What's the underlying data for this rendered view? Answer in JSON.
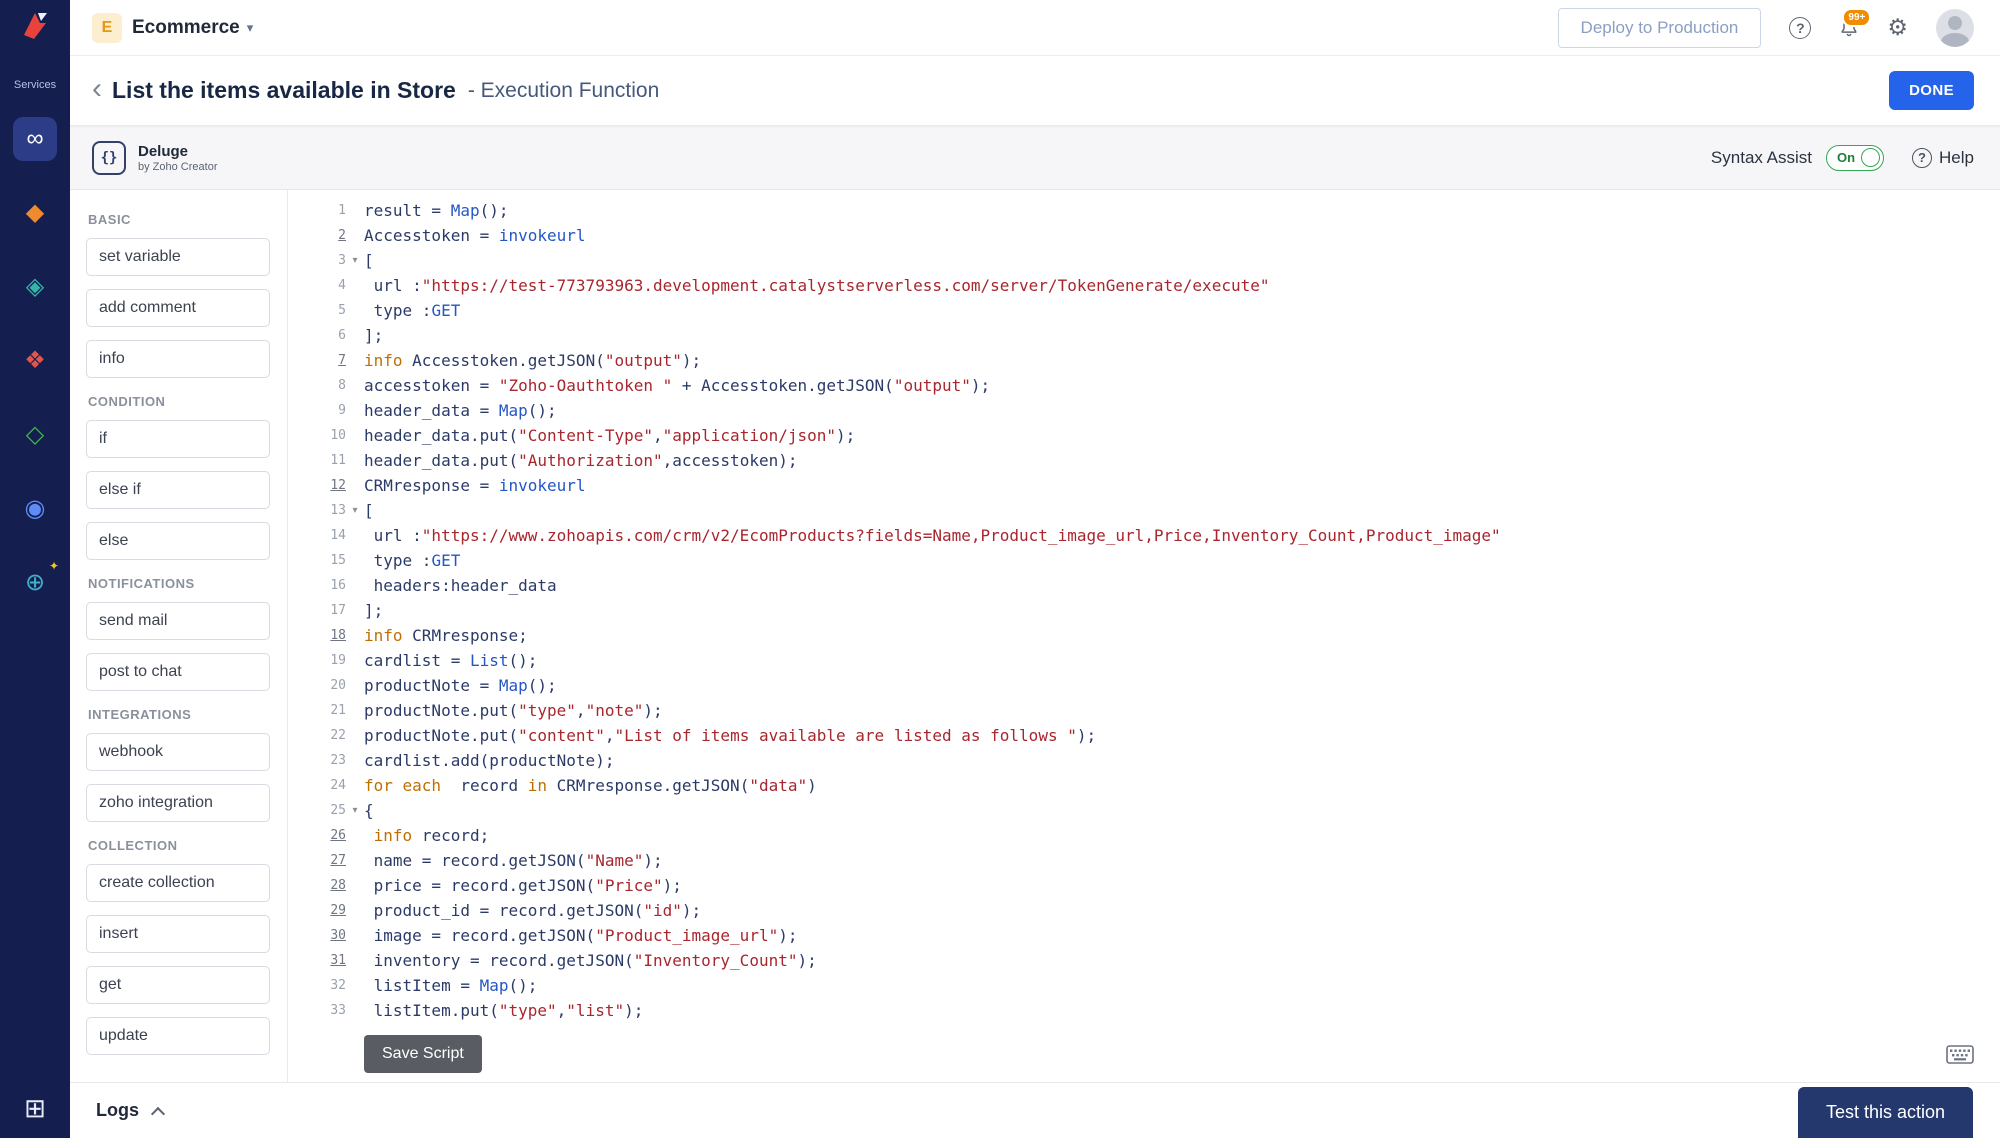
{
  "sidebar": {
    "services_label": "Services",
    "items": [
      {
        "name": "infinity-service",
        "glyph": "∞",
        "color": "#ffffff",
        "active": true
      },
      {
        "name": "diamond-orange-service",
        "glyph": "◆",
        "color": "#f08a2f"
      },
      {
        "name": "datastore-service",
        "glyph": "◈",
        "color": "#35b5a9"
      },
      {
        "name": "cluster-service",
        "glyph": "❖",
        "color": "#e0564d"
      },
      {
        "name": "diamond-green-service",
        "glyph": "◇",
        "color": "#43b649"
      },
      {
        "name": "user-service",
        "glyph": "◉",
        "color": "#5e8bf5"
      },
      {
        "name": "globe-service",
        "glyph": "⊕",
        "color": "#3fb0c9",
        "sparkle": true
      }
    ],
    "apps_grid_glyph": "⊞"
  },
  "topbar": {
    "app_badge": "E",
    "app_name": "Ecommerce",
    "caret": "▾",
    "deploy_label": "Deploy to Production",
    "notification_count": "99+",
    "help_glyph": "?",
    "gear_glyph": "⚙"
  },
  "header": {
    "back_glyph": "‹",
    "title": "List the items available in Store",
    "subtitle": "- Execution Function",
    "done_label": "DONE"
  },
  "editor_header": {
    "logo_glyph": "{}",
    "engine_name": "Deluge",
    "engine_sub": "by Zoho Creator",
    "syntax_assist_label": "Syntax Assist",
    "toggle_state": "On",
    "help_glyph": "?",
    "help_label": "Help"
  },
  "panel": {
    "sections": [
      {
        "label": "BASIC",
        "items": [
          "set variable",
          "add comment",
          "info"
        ]
      },
      {
        "label": "CONDITION",
        "items": [
          "if",
          "else if",
          "else"
        ]
      },
      {
        "label": "NOTIFICATIONS",
        "items": [
          "send mail",
          "post to chat"
        ]
      },
      {
        "label": "INTEGRATIONS",
        "items": [
          "webhook",
          "zoho integration"
        ]
      },
      {
        "label": "COLLECTION",
        "items": [
          "create collection",
          "insert",
          "get",
          "update"
        ]
      }
    ]
  },
  "code": {
    "lines": [
      {
        "n": 1,
        "t": [
          [
            "d",
            "result = "
          ],
          [
            "k",
            "Map"
          ],
          [
            "d",
            "();"
          ]
        ]
      },
      {
        "n": 2,
        "u": true,
        "t": [
          [
            "d",
            "Accesstoken = "
          ],
          [
            "k",
            "invokeurl"
          ]
        ]
      },
      {
        "n": 3,
        "fold": true,
        "t": [
          [
            "d",
            "["
          ]
        ]
      },
      {
        "n": 4,
        "t": [
          [
            "d",
            " url :"
          ],
          [
            "s",
            "\"https://test-773793963.development.catalystserverless.com/server/TokenGenerate/execute\""
          ]
        ]
      },
      {
        "n": 5,
        "t": [
          [
            "d",
            " type :"
          ],
          [
            "k",
            "GET"
          ]
        ]
      },
      {
        "n": 6,
        "t": [
          [
            "d",
            "];"
          ]
        ]
      },
      {
        "n": 7,
        "u": true,
        "t": [
          [
            "c",
            "info "
          ],
          [
            "d",
            "Accesstoken.getJSON("
          ],
          [
            "s",
            "\"output\""
          ],
          [
            "d",
            ");"
          ]
        ]
      },
      {
        "n": 8,
        "t": [
          [
            "d",
            "accesstoken = "
          ],
          [
            "s",
            "\"Zoho-Oauthtoken \""
          ],
          [
            "d",
            " + Accesstoken.getJSON("
          ],
          [
            "s",
            "\"output\""
          ],
          [
            "d",
            ");"
          ]
        ]
      },
      {
        "n": 9,
        "t": [
          [
            "d",
            "header_data = "
          ],
          [
            "k",
            "Map"
          ],
          [
            "d",
            "();"
          ]
        ]
      },
      {
        "n": 10,
        "t": [
          [
            "d",
            "header_data.put("
          ],
          [
            "s",
            "\"Content-Type\""
          ],
          [
            "d",
            ","
          ],
          [
            "s",
            "\"application/json\""
          ],
          [
            "d",
            ");"
          ]
        ]
      },
      {
        "n": 11,
        "t": [
          [
            "d",
            "header_data.put("
          ],
          [
            "s",
            "\"Authorization\""
          ],
          [
            "d",
            ",accesstoken);"
          ]
        ]
      },
      {
        "n": 12,
        "u": true,
        "t": [
          [
            "d",
            "CRMresponse = "
          ],
          [
            "k",
            "invokeurl"
          ]
        ]
      },
      {
        "n": 13,
        "fold": true,
        "t": [
          [
            "d",
            "["
          ]
        ]
      },
      {
        "n": 14,
        "t": [
          [
            "d",
            " url :"
          ],
          [
            "s",
            "\"https://www.zohoapis.com/crm/v2/EcomProducts?fields=Name,Product_image_url,Price,Inventory_Count,Product_image\""
          ]
        ]
      },
      {
        "n": 15,
        "t": [
          [
            "d",
            " type :"
          ],
          [
            "k",
            "GET"
          ]
        ]
      },
      {
        "n": 16,
        "t": [
          [
            "d",
            " headers:header_data"
          ]
        ]
      },
      {
        "n": 17,
        "t": [
          [
            "d",
            "];"
          ]
        ]
      },
      {
        "n": 18,
        "u": true,
        "t": [
          [
            "c",
            "info "
          ],
          [
            "d",
            "CRMresponse;"
          ]
        ]
      },
      {
        "n": 19,
        "t": [
          [
            "d",
            "cardlist = "
          ],
          [
            "k",
            "List"
          ],
          [
            "d",
            "();"
          ]
        ]
      },
      {
        "n": 20,
        "t": [
          [
            "d",
            "productNote = "
          ],
          [
            "k",
            "Map"
          ],
          [
            "d",
            "();"
          ]
        ]
      },
      {
        "n": 21,
        "t": [
          [
            "d",
            "productNote.put("
          ],
          [
            "s",
            "\"type\""
          ],
          [
            "d",
            ","
          ],
          [
            "s",
            "\"note\""
          ],
          [
            "d",
            ");"
          ]
        ]
      },
      {
        "n": 22,
        "t": [
          [
            "d",
            "productNote.put("
          ],
          [
            "s",
            "\"content\""
          ],
          [
            "d",
            ","
          ],
          [
            "s",
            "\"List of items available are listed as follows \""
          ],
          [
            "d",
            ");"
          ]
        ]
      },
      {
        "n": 23,
        "t": [
          [
            "d",
            "cardlist.add(productNote);"
          ]
        ]
      },
      {
        "n": 24,
        "t": [
          [
            "c",
            "for each"
          ],
          [
            "d",
            "  record "
          ],
          [
            "c",
            "in"
          ],
          [
            "d",
            " CRMresponse.getJSON("
          ],
          [
            "s",
            "\"data\""
          ],
          [
            "d",
            ")"
          ]
        ]
      },
      {
        "n": 25,
        "fold": true,
        "t": [
          [
            "d",
            "{"
          ]
        ]
      },
      {
        "n": 26,
        "u": true,
        "t": [
          [
            "d",
            " "
          ],
          [
            "c",
            "info "
          ],
          [
            "d",
            "record;"
          ]
        ]
      },
      {
        "n": 27,
        "u": true,
        "t": [
          [
            "d",
            " name = record.getJSON("
          ],
          [
            "s",
            "\"Name\""
          ],
          [
            "d",
            ");"
          ]
        ]
      },
      {
        "n": 28,
        "u": true,
        "t": [
          [
            "d",
            " price = record.getJSON("
          ],
          [
            "s",
            "\"Price\""
          ],
          [
            "d",
            ");"
          ]
        ]
      },
      {
        "n": 29,
        "u": true,
        "t": [
          [
            "d",
            " product_id = record.getJSON("
          ],
          [
            "s",
            "\"id\""
          ],
          [
            "d",
            ");"
          ]
        ]
      },
      {
        "n": 30,
        "u": true,
        "t": [
          [
            "d",
            " image = record.getJSON("
          ],
          [
            "s",
            "\"Product_image_url\""
          ],
          [
            "d",
            ");"
          ]
        ]
      },
      {
        "n": 31,
        "u": true,
        "t": [
          [
            "d",
            " inventory = record.getJSON("
          ],
          [
            "s",
            "\"Inventory_Count\""
          ],
          [
            "d",
            ");"
          ]
        ]
      },
      {
        "n": 32,
        "t": [
          [
            "d",
            " listItem = "
          ],
          [
            "k",
            "Map"
          ],
          [
            "d",
            "();"
          ]
        ]
      },
      {
        "n": 33,
        "t": [
          [
            "d",
            " listItem.put("
          ],
          [
            "s",
            "\"type\""
          ],
          [
            "d",
            ","
          ],
          [
            "s",
            "\"list\""
          ],
          [
            "d",
            ");"
          ]
        ]
      }
    ]
  },
  "footer": {
    "save_label": "Save Script",
    "logs_label": "Logs",
    "test_label": "Test this action"
  }
}
